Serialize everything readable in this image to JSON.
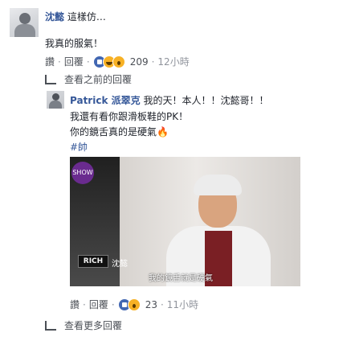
{
  "comment": {
    "author": "沈懿",
    "snippet": "這樣仿…",
    "text": "我真的服氣！",
    "actions": {
      "like": "讚",
      "reply": "回覆"
    },
    "reaction_count": "209",
    "time": "12小時"
  },
  "view_previous": "查看之前的回覆",
  "reply": {
    "author": "Patrick 派翠克",
    "line1": "我的天！本人！！沈懿哥！！",
    "line2": "我還有看你跟滑板鞋的PK！",
    "line3": "你的鏡舌真的是硬氣🔥",
    "hashtag": "#帥",
    "video": {
      "badge_text": "SHOW",
      "logo_text": "RICH",
      "name_tag": "沈懿",
      "subtitle": "我的鏡舌就是硬氣"
    },
    "actions": {
      "like": "讚",
      "reply": "回覆"
    },
    "reaction_count": "23",
    "time": "11小時"
  },
  "view_more": "查看更多回覆",
  "icons": {
    "reply_arrow": "reply-arrow-icon",
    "like": "like-reaction-icon",
    "haha": "haha-reaction-icon",
    "wow": "wow-reaction-icon"
  }
}
